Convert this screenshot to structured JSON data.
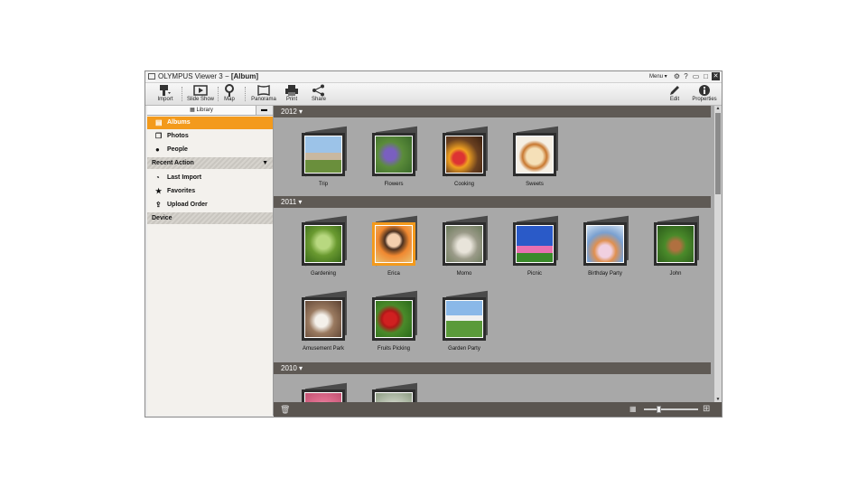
{
  "window": {
    "app_name": "OLYMPUS Viewer 3",
    "separator": " − ",
    "view_name": "[Album]",
    "menu_label": "Menu ▾"
  },
  "toolbar": {
    "import": "Import",
    "slideshow": "Slide Show",
    "map": "Map",
    "panorama": "Panorama",
    "print": "Print",
    "share": "Share",
    "edit": "Edit",
    "properties": "Properties"
  },
  "sidebar": {
    "library_tab": "Library",
    "items": [
      {
        "label": "Albums",
        "icon": "album-icon"
      },
      {
        "label": "Photos",
        "icon": "photos-icon"
      },
      {
        "label": "People",
        "icon": "person-icon"
      }
    ],
    "recent_header": "Recent Action",
    "recent_items": [
      {
        "label": "Last Import",
        "icon": "clock-icon"
      },
      {
        "label": "Favorites",
        "icon": "star-icon"
      },
      {
        "label": "Upload Order",
        "icon": "upload-icon"
      }
    ],
    "device_header": "Device"
  },
  "years": [
    {
      "label": "2012 ▾",
      "albums": [
        "Trip",
        "Flowers",
        "Cooking",
        "Sweets"
      ]
    },
    {
      "label": "2011 ▾",
      "albums": [
        "Gardening",
        "Erica",
        "Momo",
        "Picnic",
        "Birthday Party",
        "John",
        "Amusement Park",
        "Fruits Picking",
        "Garden Party"
      ]
    },
    {
      "label": "2010 ▾",
      "albums": [
        "",
        ""
      ]
    }
  ],
  "selected_album": "Erica",
  "zoom_level": 0.25,
  "colors": {
    "accent": "#f39a1c",
    "year_bar": "#5f5a55",
    "content_bg": "#a8a8a8"
  }
}
